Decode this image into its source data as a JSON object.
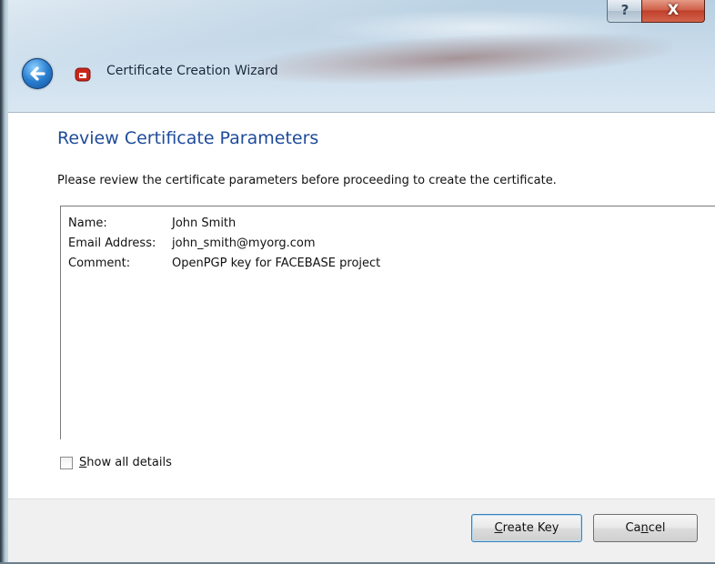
{
  "window": {
    "title": "Certificate Creation Wizard",
    "help_glyph": "?",
    "close_glyph": "X"
  },
  "icons": {
    "back": "back-arrow-icon",
    "app": "certificate-app-icon"
  },
  "page": {
    "heading": "Review Certificate Parameters",
    "description": "Please review the certificate parameters before proceeding to create the certificate."
  },
  "parameters": [
    {
      "label": "Name:",
      "value": "John Smith"
    },
    {
      "label": "Email Address:",
      "value": "john_smith@myorg.com"
    },
    {
      "label": "Comment:",
      "value": "OpenPGP key for FACEBASE project"
    }
  ],
  "options": {
    "show_all_details": {
      "label_mnemonic": "S",
      "label_rest": "how all details",
      "checked": false
    }
  },
  "buttons": {
    "create_key": {
      "mnemonic": "C",
      "rest": "reate Key"
    },
    "cancel": {
      "prefix": "Ca",
      "mnemonic": "n",
      "rest": "cel"
    }
  },
  "colors": {
    "heading": "#1e4b9a",
    "close_button": "#c0412b",
    "default_button_border": "#3c7fb1"
  }
}
